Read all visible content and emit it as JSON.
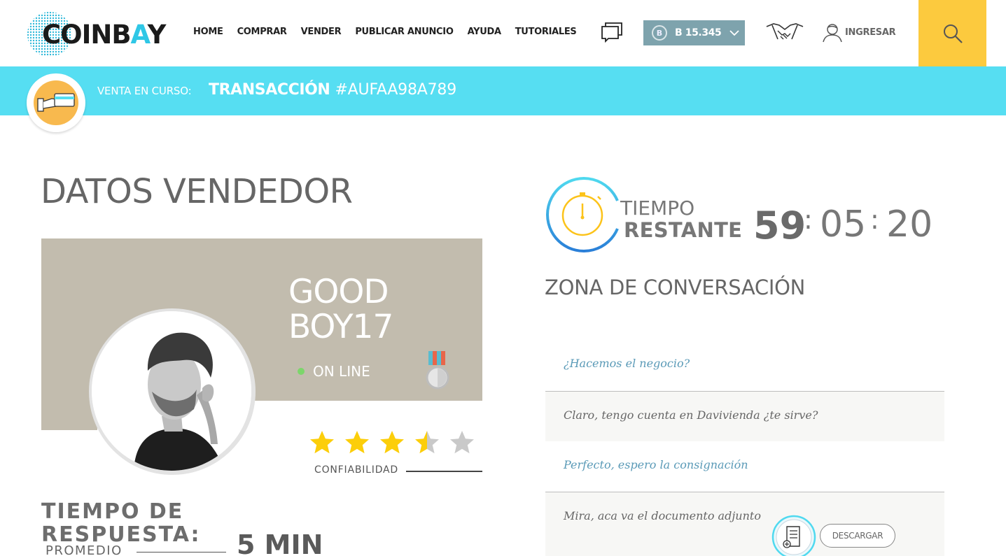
{
  "brand": {
    "logo_text_pre": "COINB",
    "logo_text_accent": "A",
    "logo_text_post": "Y"
  },
  "nav": {
    "items": [
      "HOME",
      "COMPRAR",
      "VENDER",
      "PUBLICAR ANUNCIO",
      "AYUDA",
      "TUTORIALES"
    ]
  },
  "header": {
    "btc_symbol": "B",
    "btc_balance": "B 15.345",
    "login_label": "INGRESAR"
  },
  "banner": {
    "label": "VENTA EN CURSO:",
    "tx_word": "TRANSACCIÓN",
    "tx_id": "#AUFAA98A789"
  },
  "vendor": {
    "section_title": "DATOS VENDEDOR",
    "name_line1": "GOOD",
    "name_line2": "BOY17",
    "status": "ON LINE",
    "rating": 3.5,
    "rating_max": 5,
    "reliability_label": "CONFIABILIDAD",
    "response_title_1": "TIEMPO DE",
    "response_title_2": "RESPUESTA:",
    "response_avg_label": "PROMEDIO",
    "response_value": "5 MIN"
  },
  "timer": {
    "label_1": "TIEMPO",
    "label_2": "RESTANTE",
    "hours": "59",
    "minutes": "05",
    "seconds": "20",
    "separator": ":"
  },
  "conversation": {
    "title": "ZONA DE CONVERSACIÓN",
    "messages": [
      {
        "text": "¿Hacemos el negocio?"
      },
      {
        "text": "Claro, tengo cuenta en Davivienda ¿te sirve?"
      },
      {
        "text": "Perfecto, espero la consignación"
      },
      {
        "text": "Mira, aca va el documento adjunto"
      }
    ],
    "download_label": "DESCARGAR"
  },
  "colors": {
    "accent_cyan": "#56def2",
    "search_yellow": "#fcca3e",
    "btc_box": "#7ea3ad",
    "card_bg": "#c2bcae",
    "star_yellow": "#fcce0a",
    "star_grey": "#c9c9c9",
    "online_green": "#7cd66b"
  },
  "icons": [
    "globe-logo-icon",
    "chat-icon",
    "bitcoin-icon",
    "chevron-down-icon",
    "handshake-icon",
    "user-icon",
    "search-icon",
    "card-payment-icon",
    "medal-icon",
    "star-icon",
    "stopwatch-icon",
    "document-icon"
  ]
}
